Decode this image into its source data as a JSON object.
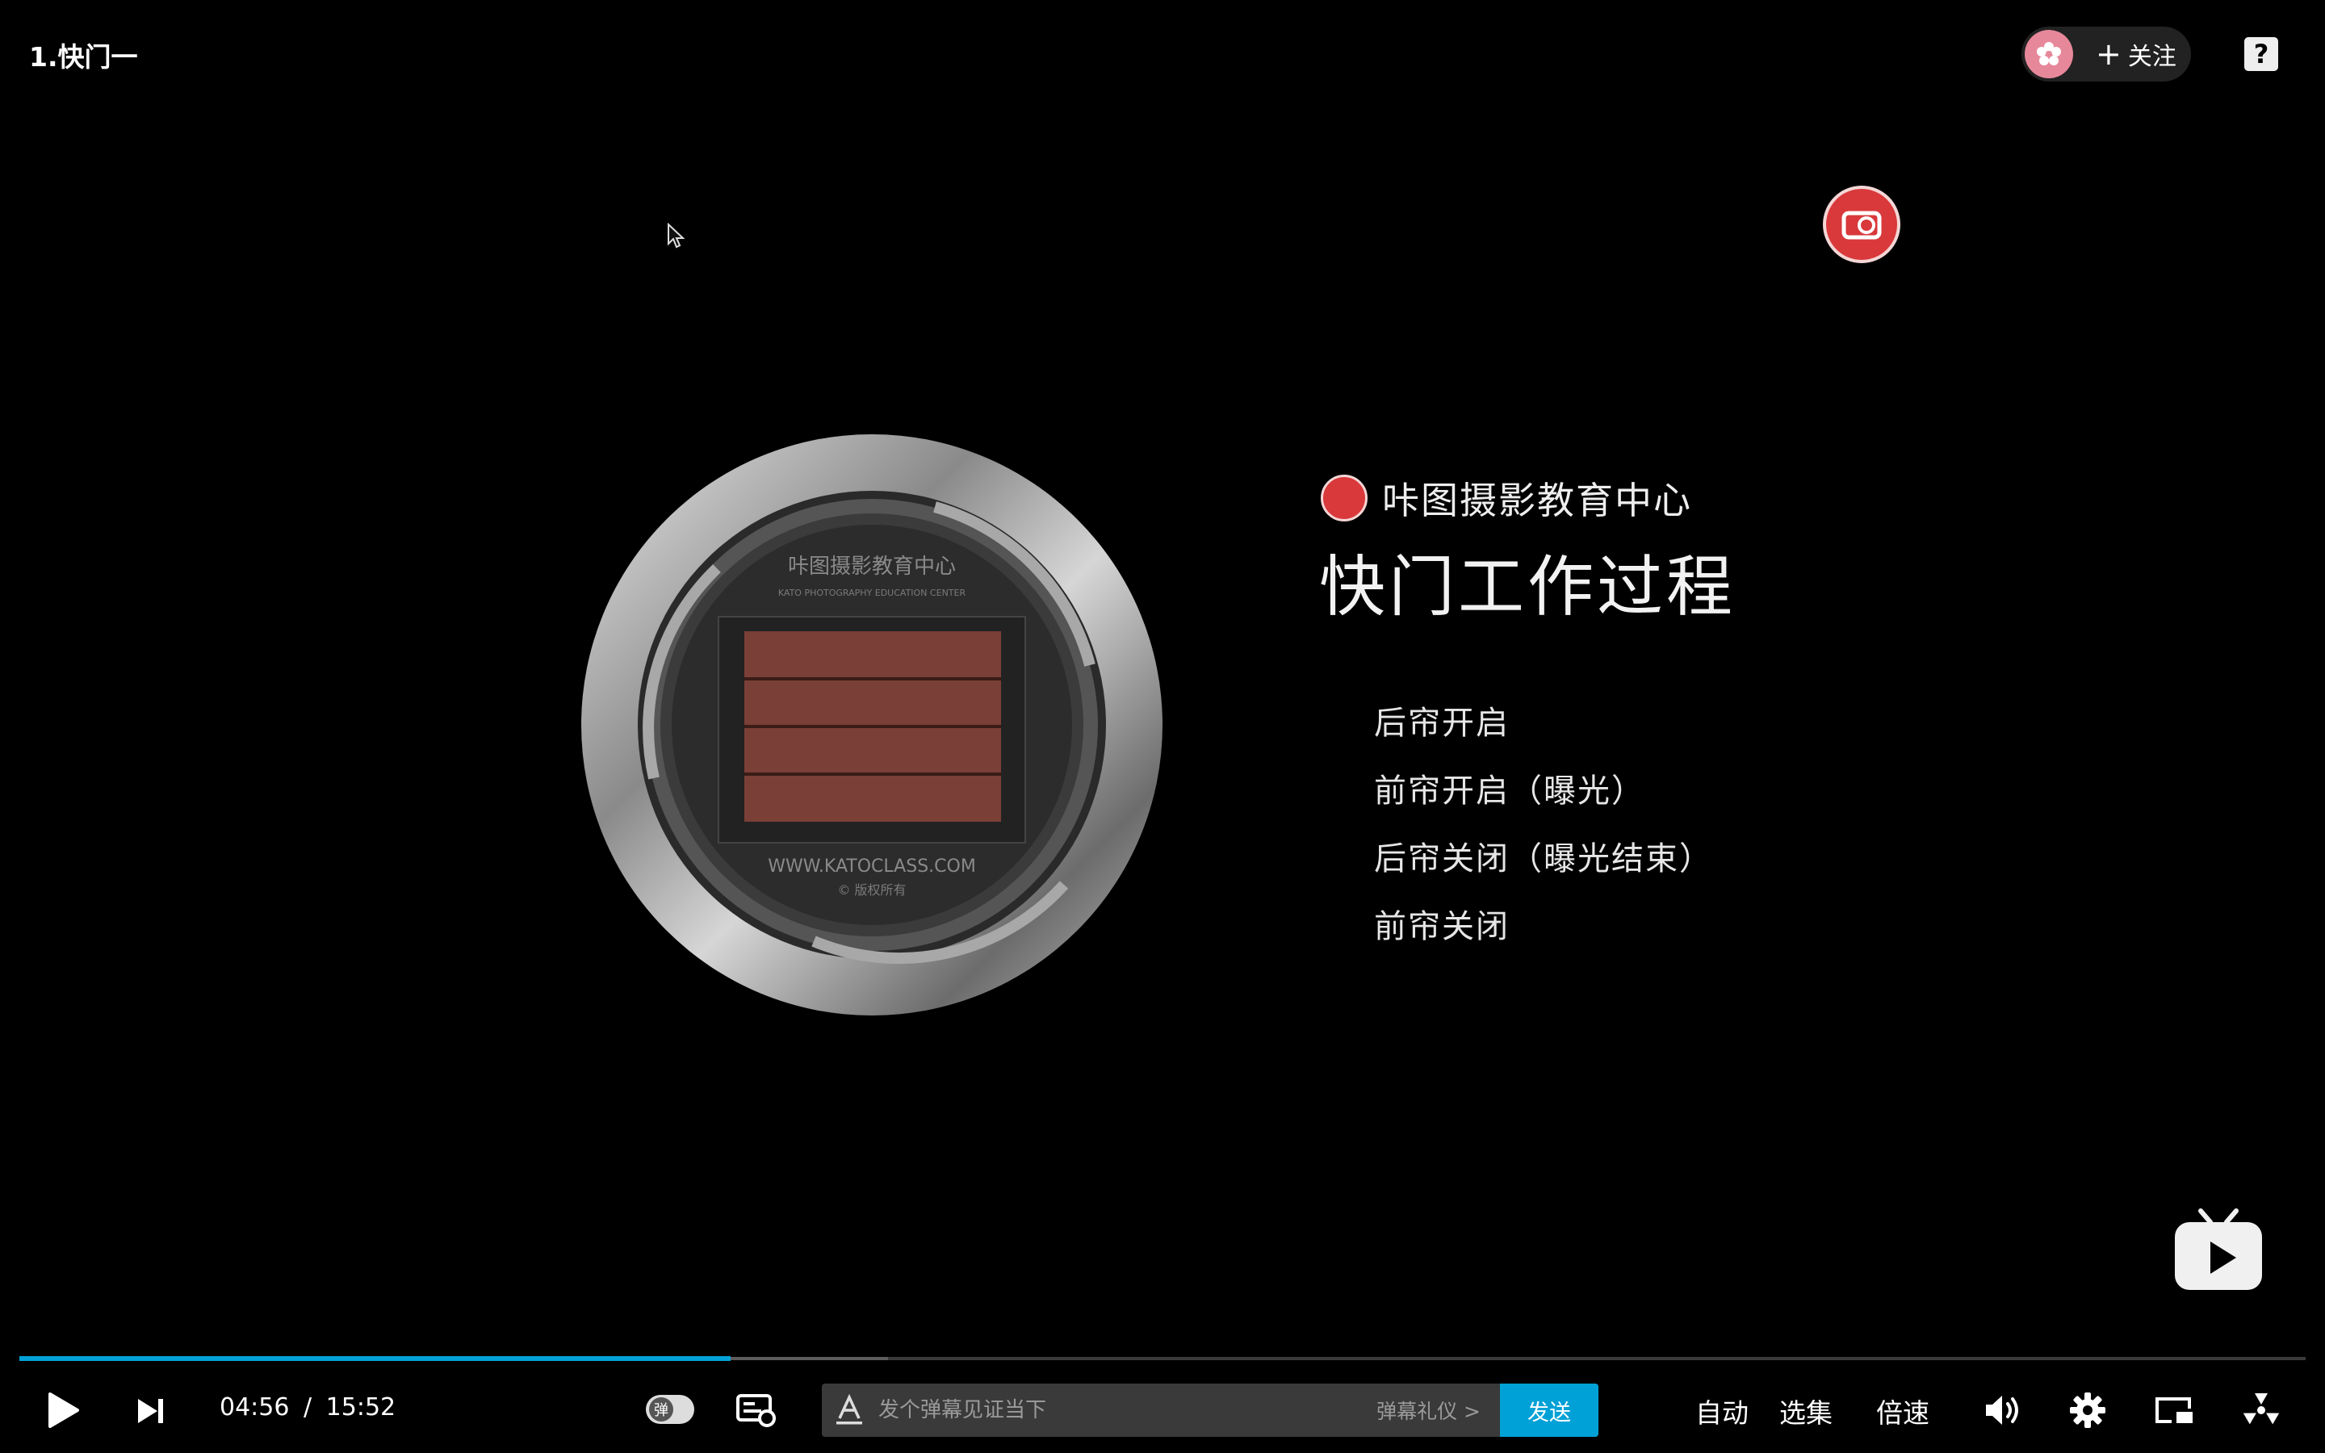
{
  "video": {
    "title": "1.快门一",
    "brand_name": "咔图摄影教育中心",
    "headline": "快门工作过程",
    "steps": [
      "后帘开启",
      "前帘开启（曝光）",
      "后帘关闭（曝光结束）",
      "前帘关闭"
    ],
    "dial_text": {
      "top_cn": "咔图摄影教育中心",
      "top_en": "KATO PHOTOGRAPHY EDUCATION CENTER",
      "url": "WWW.KATOCLASS.COM",
      "copyright": "© 版权所有"
    }
  },
  "uploader": {
    "follow_label": "关注"
  },
  "player": {
    "current_time": "04:56",
    "separator": "/",
    "duration": "15:52",
    "progress_fraction": 0.311,
    "buffered_fraction": 0.38,
    "danmaku_toggle_glyph": "弹",
    "danmaku_placeholder": "发个弹幕见证当下",
    "danmaku_etiquette": "弹幕礼仪 >",
    "send_label": "发送",
    "auto_label": "自动",
    "episodes_label": "选集",
    "speed_label": "倍速"
  },
  "colors": {
    "accent": "#00a1d6",
    "logo_red": "#d9393b",
    "shutter_curtain": "#7a3f36"
  }
}
